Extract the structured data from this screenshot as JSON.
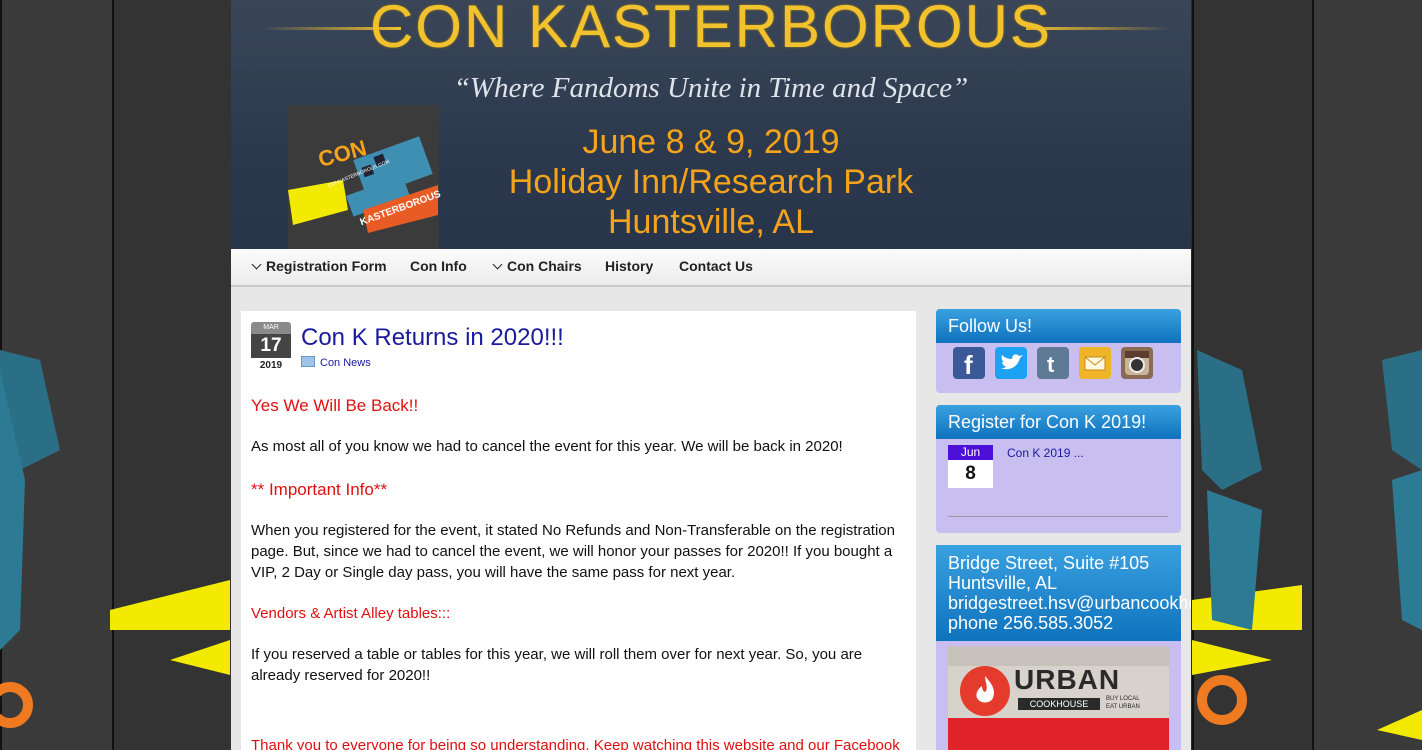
{
  "header": {
    "site_title": "CON KASTERBOROUS",
    "tagline": "“Where Fandoms Unite in Time and Space”",
    "event_date": "June 8 & 9, 2019",
    "event_venue": "Holiday Inn/Research Park",
    "event_city": "Huntsville, AL",
    "logo_con": "CON",
    "logo_url": "CONKASTERBOROUS.COM",
    "logo_name": "KASTERBOROUS"
  },
  "nav": {
    "items": [
      {
        "label": "Registration Form",
        "dropdown": true
      },
      {
        "label": "Con Info",
        "dropdown": false
      },
      {
        "label": "Con Chairs",
        "dropdown": true
      },
      {
        "label": "History",
        "dropdown": false
      },
      {
        "label": "Contact Us",
        "dropdown": false
      }
    ]
  },
  "post": {
    "date_month": "MAR",
    "date_day": "17",
    "date_year": "2019",
    "title": "Con K Returns in 2020!!!",
    "category": "Con News",
    "heading1": "Yes We Will Be Back!!",
    "para1": "As most all of you know we had to cancel the event for this year. We will be back in 2020!",
    "heading2": "** Important Info**",
    "para2": "When you registered for the event, it stated No Refunds and Non-Transferable on the registration page. But, since we had to cancel the event, we will honor your passes for 2020!! If you bought a VIP, 2 Day or Single day pass, you will have the same pass for next year.",
    "heading3": "Vendors & Artist Alley tables:::",
    "para3": "If you reserved a table or tables for this year, we will roll them over for next year. So, you are already reserved for 2020!!",
    "closing": "Thank you to everyone for being so understanding. Keep watching this website and our Facebook"
  },
  "sidebar": {
    "follow": {
      "title": "Follow Us!",
      "icons": [
        "facebook-icon",
        "twitter-icon",
        "tumblr-icon",
        "email-icon",
        "instagram-icon"
      ],
      "colors": {
        "facebook": "#3b5998",
        "twitter": "#1da1f2",
        "tumblr": "#5f7a95",
        "email": "#f0b429",
        "instagram": "#8a6a52"
      }
    },
    "register": {
      "title": "Register for Con K 2019!",
      "month": "Jun",
      "day": "8",
      "event": "Con K 2019 ..."
    },
    "address": {
      "line1": "Bridge Street, Suite #105",
      "line2": "Huntsville, AL",
      "line3": "bridgestreet.hsv@urbancookhouse.com",
      "line4": "phone 256.585.3052",
      "ad_brand": "URBAN",
      "ad_sub": "COOKHOUSE",
      "ad_tag1": "BUY LOCAL",
      "ad_tag2": "EAT URBAN"
    }
  },
  "colors": {
    "accent_blue": "#0f72bd",
    "title_gold": "#f2c12e",
    "info_orange": "#f5a31a",
    "alert_red": "#e01010",
    "sidebar_lavender": "#c8bef0"
  }
}
